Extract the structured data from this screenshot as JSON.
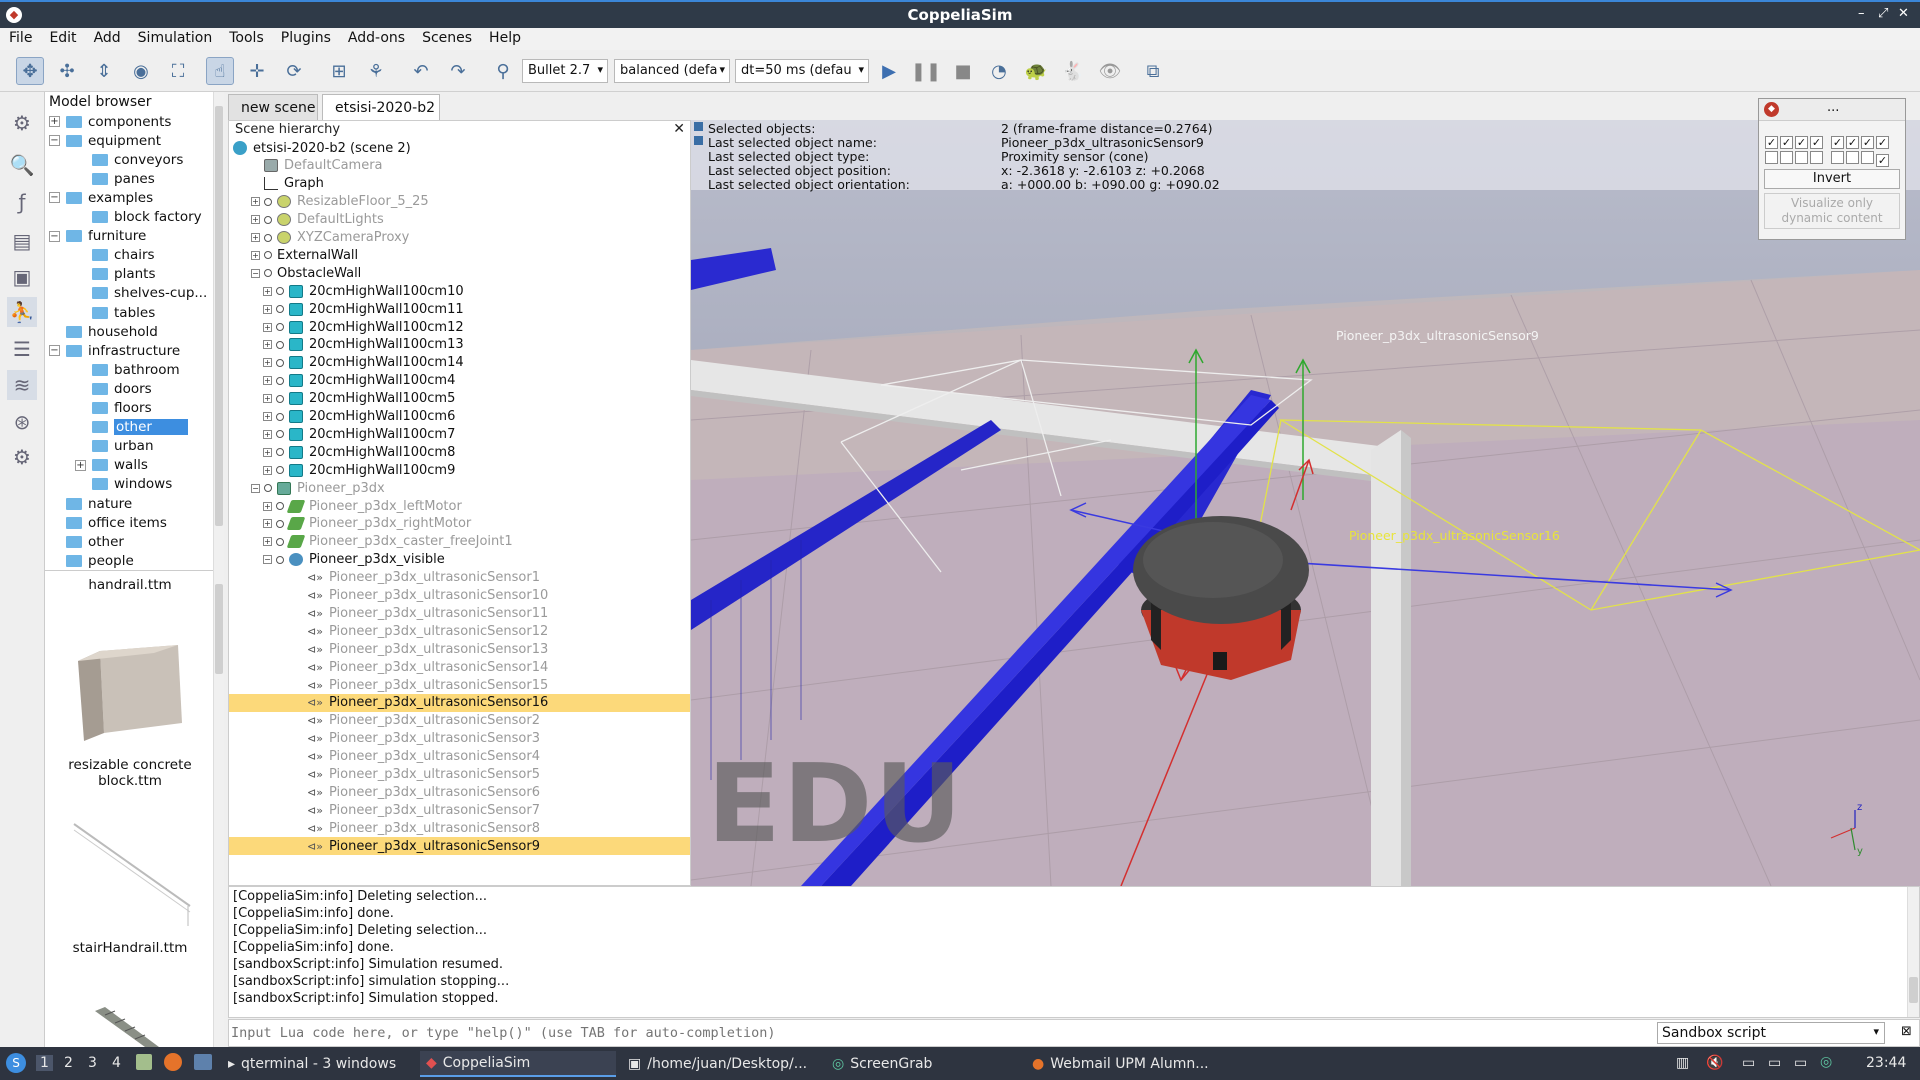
{
  "window": {
    "title": "CoppeliaSim",
    "controls": [
      "–",
      "⤢",
      "✕"
    ]
  },
  "menu": [
    "File",
    "Edit",
    "Add",
    "Simulation",
    "Tools",
    "Plugins",
    "Add-ons",
    "Scenes",
    "Help"
  ],
  "toolbar": {
    "engine": "Bullet 2.7",
    "mode": "balanced (defa",
    "dt": "dt=50 ms (defau"
  },
  "model_browser": {
    "header": "Model browser",
    "items": [
      {
        "label": "components",
        "level": 0,
        "exp": "+"
      },
      {
        "label": "equipment",
        "level": 0,
        "exp": "−"
      },
      {
        "label": "conveyors",
        "level": 1
      },
      {
        "label": "panes",
        "level": 1
      },
      {
        "label": "examples",
        "level": 0,
        "exp": "−"
      },
      {
        "label": "block factory",
        "level": 1
      },
      {
        "label": "furniture",
        "level": 0,
        "exp": "−"
      },
      {
        "label": "chairs",
        "level": 1
      },
      {
        "label": "plants",
        "level": 1
      },
      {
        "label": "shelves-cup...",
        "level": 1
      },
      {
        "label": "tables",
        "level": 1
      },
      {
        "label": "household",
        "level": 0
      },
      {
        "label": "infrastructure",
        "level": 0,
        "exp": "−"
      },
      {
        "label": "bathroom",
        "level": 1
      },
      {
        "label": "doors",
        "level": 1
      },
      {
        "label": "floors",
        "level": 1
      },
      {
        "label": "other",
        "level": 1,
        "selected": true
      },
      {
        "label": "urban",
        "level": 1
      },
      {
        "label": "walls",
        "level": 1,
        "exp": "+"
      },
      {
        "label": "windows",
        "level": 1
      },
      {
        "label": "nature",
        "level": 0
      },
      {
        "label": "office items",
        "level": 0
      },
      {
        "label": "other",
        "level": 0
      },
      {
        "label": "people",
        "level": 0
      }
    ],
    "thumbnails": [
      "handrail.ttm",
      "resizable concrete\nblock.ttm",
      "stairHandrail.ttm"
    ]
  },
  "tabs": [
    "new scene",
    "etsisi-2020-b2"
  ],
  "hierarchy": {
    "header": "Scene hierarchy",
    "items": [
      {
        "label": "etsisi-2020-b2 (scene 2)",
        "indent": 0,
        "icon": "scene"
      },
      {
        "label": "DefaultCamera",
        "indent": 1,
        "icon": "cam",
        "gray": true
      },
      {
        "label": "Graph",
        "indent": 1,
        "icon": "graph"
      },
      {
        "label": "ResizableFloor_5_25",
        "indent": 1,
        "icon": "light",
        "gray": true,
        "exp": "+"
      },
      {
        "label": "DefaultLights",
        "indent": 1,
        "icon": "light",
        "gray": true,
        "exp": "+"
      },
      {
        "label": "XYZCameraProxy",
        "indent": 1,
        "icon": "light",
        "gray": true,
        "exp": "+"
      },
      {
        "label": "ExternalWall",
        "indent": 1,
        "icon": "none",
        "exp": "+"
      },
      {
        "label": "ObstacleWall",
        "indent": 1,
        "icon": "none",
        "exp": "−"
      },
      {
        "label": "20cmHighWall100cm10",
        "indent": 2,
        "icon": "cube",
        "exp": "+"
      },
      {
        "label": "20cmHighWall100cm11",
        "indent": 2,
        "icon": "cube",
        "exp": "+"
      },
      {
        "label": "20cmHighWall100cm12",
        "indent": 2,
        "icon": "cube",
        "exp": "+"
      },
      {
        "label": "20cmHighWall100cm13",
        "indent": 2,
        "icon": "cube",
        "exp": "+"
      },
      {
        "label": "20cmHighWall100cm14",
        "indent": 2,
        "icon": "cube",
        "exp": "+"
      },
      {
        "label": "20cmHighWall100cm4",
        "indent": 2,
        "icon": "cube",
        "exp": "+"
      },
      {
        "label": "20cmHighWall100cm5",
        "indent": 2,
        "icon": "cube",
        "exp": "+"
      },
      {
        "label": "20cmHighWall100cm6",
        "indent": 2,
        "icon": "cube",
        "exp": "+"
      },
      {
        "label": "20cmHighWall100cm7",
        "indent": 2,
        "icon": "cube",
        "exp": "+"
      },
      {
        "label": "20cmHighWall100cm8",
        "indent": 2,
        "icon": "cube",
        "exp": "+"
      },
      {
        "label": "20cmHighWall100cm9",
        "indent": 2,
        "icon": "cube",
        "exp": "+"
      },
      {
        "label": "Pioneer_p3dx",
        "indent": 1,
        "icon": "shape",
        "gray": true,
        "exp": "−"
      },
      {
        "label": "Pioneer_p3dx_leftMotor",
        "indent": 2,
        "icon": "joint",
        "gray": true,
        "exp": "+"
      },
      {
        "label": "Pioneer_p3dx_rightMotor",
        "indent": 2,
        "icon": "joint",
        "gray": true,
        "exp": "+"
      },
      {
        "label": "Pioneer_p3dx_caster_freeJoint1",
        "indent": 2,
        "icon": "joint",
        "gray": true,
        "exp": "+"
      },
      {
        "label": "Pioneer_p3dx_visible",
        "indent": 2,
        "icon": "dummy",
        "exp": "−"
      },
      {
        "label": "Pioneer_p3dx_ultrasonicSensor1",
        "indent": 3,
        "icon": "sensor",
        "gray": true
      },
      {
        "label": "Pioneer_p3dx_ultrasonicSensor10",
        "indent": 3,
        "icon": "sensor",
        "gray": true
      },
      {
        "label": "Pioneer_p3dx_ultrasonicSensor11",
        "indent": 3,
        "icon": "sensor",
        "gray": true
      },
      {
        "label": "Pioneer_p3dx_ultrasonicSensor12",
        "indent": 3,
        "icon": "sensor",
        "gray": true
      },
      {
        "label": "Pioneer_p3dx_ultrasonicSensor13",
        "indent": 3,
        "icon": "sensor",
        "gray": true
      },
      {
        "label": "Pioneer_p3dx_ultrasonicSensor14",
        "indent": 3,
        "icon": "sensor",
        "gray": true
      },
      {
        "label": "Pioneer_p3dx_ultrasonicSensor15",
        "indent": 3,
        "icon": "sensor",
        "gray": true
      },
      {
        "label": "Pioneer_p3dx_ultrasonicSensor16",
        "indent": 3,
        "icon": "sensor",
        "selected": true
      },
      {
        "label": "Pioneer_p3dx_ultrasonicSensor2",
        "indent": 3,
        "icon": "sensor",
        "gray": true
      },
      {
        "label": "Pioneer_p3dx_ultrasonicSensor3",
        "indent": 3,
        "icon": "sensor",
        "gray": true
      },
      {
        "label": "Pioneer_p3dx_ultrasonicSensor4",
        "indent": 3,
        "icon": "sensor",
        "gray": true
      },
      {
        "label": "Pioneer_p3dx_ultrasonicSensor5",
        "indent": 3,
        "icon": "sensor",
        "gray": true
      },
      {
        "label": "Pioneer_p3dx_ultrasonicSensor6",
        "indent": 3,
        "icon": "sensor",
        "gray": true
      },
      {
        "label": "Pioneer_p3dx_ultrasonicSensor7",
        "indent": 3,
        "icon": "sensor",
        "gray": true
      },
      {
        "label": "Pioneer_p3dx_ultrasonicSensor8",
        "indent": 3,
        "icon": "sensor",
        "gray": true
      },
      {
        "label": "Pioneer_p3dx_ultrasonicSensor9",
        "indent": 3,
        "icon": "sensor",
        "selected": true
      }
    ]
  },
  "info_overlay": {
    "rows": [
      {
        "k": "Selected objects:",
        "v": "2 (frame-frame distance=0.2764)"
      },
      {
        "k": "Last selected object name:",
        "v": "Pioneer_p3dx_ultrasonicSensor9"
      },
      {
        "k": "Last selected object type:",
        "v": "Proximity sensor (cone)"
      },
      {
        "k": "Last selected object position:",
        "v": "x: -2.3618    y: -2.6103    z: +0.2068"
      },
      {
        "k": "Last selected object orientation:",
        "v": "a: +000.00    b: +090.00    g: +090.02"
      }
    ]
  },
  "viewport": {
    "watermark": "EDU",
    "label_sensor9": "Pioneer_p3dx_ultrasonicSensor9",
    "label_sensor16": "Pioneer_p3dx_ultrasonicSensor16",
    "axes": {
      "z": "z",
      "y": "y"
    }
  },
  "mini_panel": {
    "title": "...",
    "invert": "Invert",
    "visualize": "Visualize only\ndynamic content"
  },
  "console": {
    "lines": [
      "[CoppeliaSim:info] Deleting selection...",
      "[CoppeliaSim:info] done.",
      "[CoppeliaSim:info] Deleting selection...",
      "[CoppeliaSim:info] done.",
      "[sandboxScript:info] Simulation resumed.",
      "[sandboxScript:info] simulation stopping...",
      "[sandboxScript:info] Simulation stopped."
    ]
  },
  "lua": {
    "placeholder": "Input Lua code here, or type \"help()\" (use TAB for auto-completion)",
    "script_select": "Sandbox script"
  },
  "taskbar": {
    "workspaces": [
      "1",
      "2",
      "3",
      "4"
    ],
    "tasks": [
      "qterminal - 3 windows",
      "CoppeliaSim",
      "/home/juan/Desktop/...",
      "ScreenGrab",
      "Webmail UPM Alumn..."
    ],
    "clock": "23:44"
  },
  "colors": {
    "accent": "#3d8ee0",
    "highlight": "#fcd97a",
    "wall": "#2222cc"
  }
}
